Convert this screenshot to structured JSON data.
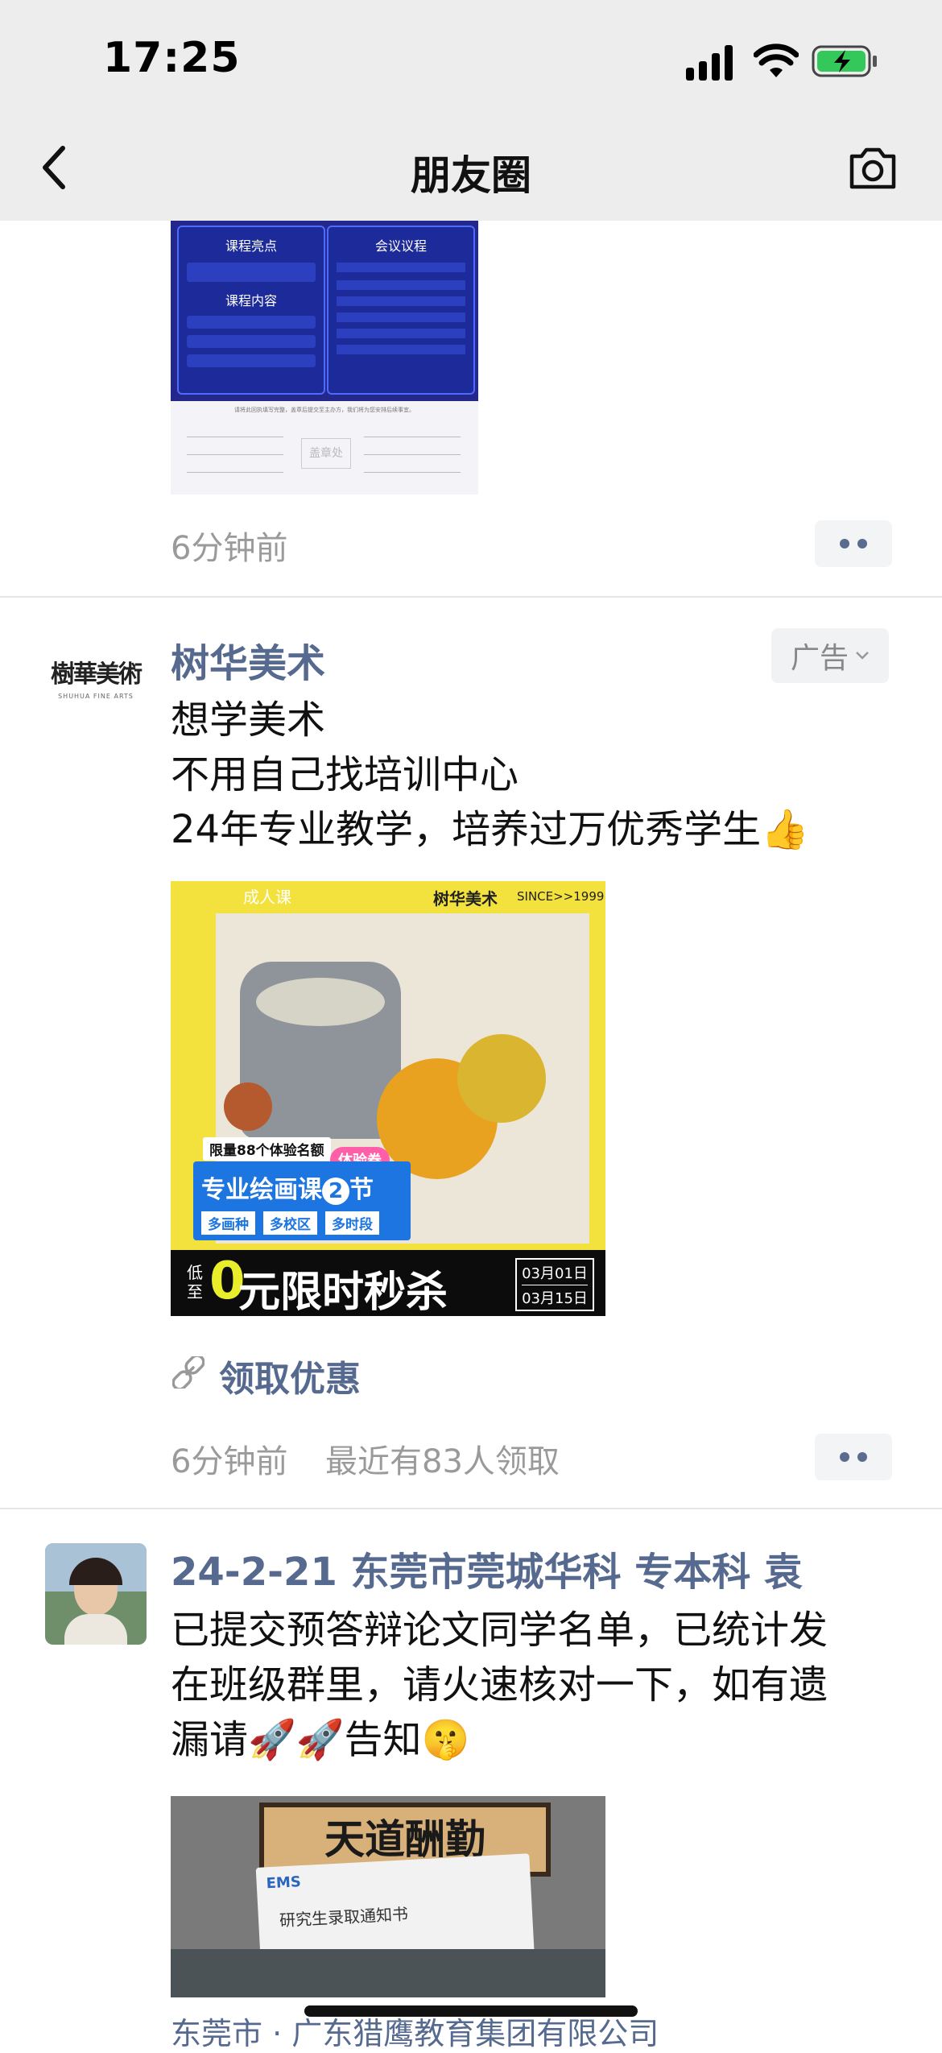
{
  "status_bar": {
    "time": "17:25"
  },
  "nav": {
    "title": "朋友圈"
  },
  "post_prev": {
    "poster": {
      "left_title1": "课程亮点",
      "left_title2": "课程内容",
      "right_title": "会议议程",
      "stamp": "盖章处",
      "bottom_text": "请将此回执填写完整，盖章后提交至主办方，我们将为您安排后续事宜。"
    },
    "time": "6分钟前"
  },
  "post_ad": {
    "name": "树华美术",
    "ad_label": "广告",
    "avatar_text": "樹華美術",
    "avatar_sub": "SHUHUA FINE ARTS",
    "lines": [
      "想学美术",
      "不用自己找培训中心",
      "24年专业教学，培养过万优秀学生👍"
    ],
    "image": {
      "tag": "成人课",
      "brand": "树华美术",
      "since": "SINCE>>1999",
      "quota": "限量88个体验名额",
      "badge": "体验券",
      "course_prefix": "专业绘画课",
      "course_num": "2",
      "course_suffix": "节",
      "chips": [
        "多画种",
        "多校区",
        "多时段"
      ],
      "low": "低至",
      "zero": "0",
      "offer": "元限时秒杀",
      "date1": "03月01日",
      "date2": "03月15日"
    },
    "link_label": "领取优惠",
    "time": "6分钟前",
    "claim": "最近有83人领取"
  },
  "post_third": {
    "name": "24-2-21 东莞市莞城华科 专本科 袁",
    "lines": [
      "已提交预答辩论文同学名单，已统计发",
      "在班级群里，请火速核对一下，如有遗",
      "漏请🚀🚀告知🤫"
    ],
    "image": {
      "calligraphy": "天道酬勤",
      "card_head": "EMS",
      "card_title": "研究生录取通知书"
    },
    "location": "东莞市 · 广东猎鹰教育集团有限公司"
  }
}
